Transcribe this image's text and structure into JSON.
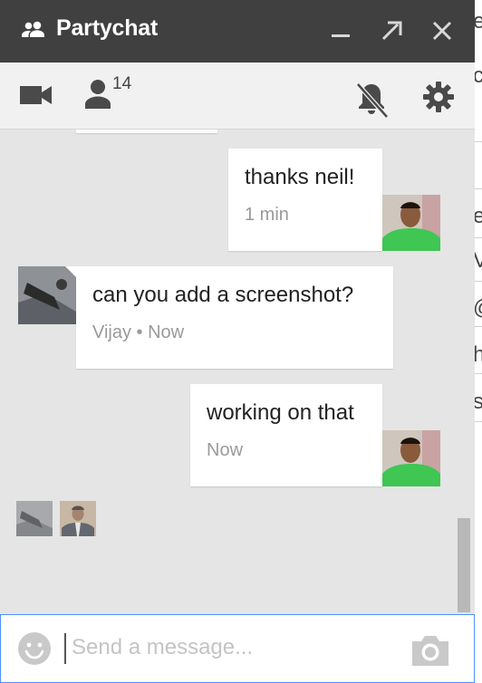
{
  "titlebar": {
    "title": "Partychat",
    "minimize_icon": "minimize-icon",
    "popout_icon": "popout-arrow-icon",
    "close_icon": "close-icon"
  },
  "toolbar": {
    "participant_count": "14",
    "video_icon": "video-camera-icon",
    "people_icon": "person-icon",
    "mute_icon": "notifications-off-icon",
    "settings_icon": "gear-icon"
  },
  "messages": [
    {
      "text": "thanks neil!",
      "meta": "1 min",
      "side": "right"
    },
    {
      "text": "can you add a screenshot?",
      "meta": "Vijay • Now",
      "side": "left"
    },
    {
      "text": "working on that",
      "meta": "Now",
      "side": "right"
    }
  ],
  "composer": {
    "placeholder": "Send a message...",
    "emoji_icon": "emoji-icon",
    "camera_icon": "camera-icon"
  },
  "right_panel": {
    "chars": [
      "e",
      "c",
      "e",
      "V",
      "@",
      "h",
      "s"
    ]
  },
  "colors": {
    "titlebar": "#404040",
    "toolbar": "#f1f1f1",
    "chat_bg": "#e5e5e5",
    "bubble": "#ffffff",
    "focus_border": "#4d90fe",
    "meta_text": "#9a9a9a",
    "avatar_shirt": "#3fc653"
  }
}
